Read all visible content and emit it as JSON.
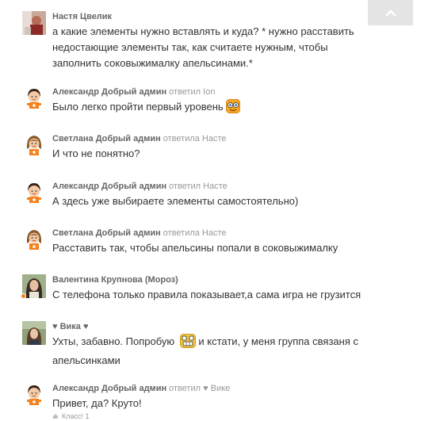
{
  "scroll_top": {
    "icon": "chevron-up-icon"
  },
  "comments": [
    {
      "author": "Настя Цвелик",
      "reply_to": "",
      "text": "а какие элементы нужно вставлять и куда? * нужно расставить недостающие элементы так, как считаете нужным, чтобы заполнить соковыжималку апельсинами.*",
      "avatar": "photo-avatar"
    },
    {
      "author": "Александр Добрый админ",
      "reply_to": "ответил Ion",
      "text": "Было легко пройти первый уровень",
      "avatar": "boy-avatar",
      "emoji": "glasses-smiley-icon"
    },
    {
      "author": "Светлана Добрый админ",
      "reply_to": "ответила Насте",
      "text": "И что не понятно?",
      "avatar": "girl-avatar"
    },
    {
      "author": "Александр Добрый админ",
      "reply_to": "ответил Насте",
      "text": "А здесь уже выбираете элементы самостоятельно)",
      "avatar": "boy-avatar"
    },
    {
      "author": "Светлана Добрый админ",
      "reply_to": "ответила Насте",
      "text": "Расставить так, чтобы апельсины попали в соковыжималку",
      "avatar": "girl-avatar"
    },
    {
      "author": "Валентина Крупнова (Мороз)",
      "reply_to": "",
      "text": "С телефона только правила показывает,а сама игра не грузится",
      "avatar": "photo-avatar",
      "online": true
    },
    {
      "author": "♥ Вика ♥",
      "reply_to": "",
      "text_before": "Ухты, забавно. Попробую",
      "text_after": "и кстати, у меня группа связаня с апельсинками",
      "avatar": "photo-avatar",
      "emoji": "grin-smiley-icon"
    },
    {
      "author": "Александр Добрый админ",
      "reply_to": "ответил ♥ Вике",
      "text": "Привет, да? Круто!",
      "avatar": "boy-avatar",
      "likes": "Класс! 1"
    }
  ],
  "colors": {
    "author": "#666666",
    "reply": "#999999",
    "text": "#333333",
    "accent": "#f58220"
  }
}
